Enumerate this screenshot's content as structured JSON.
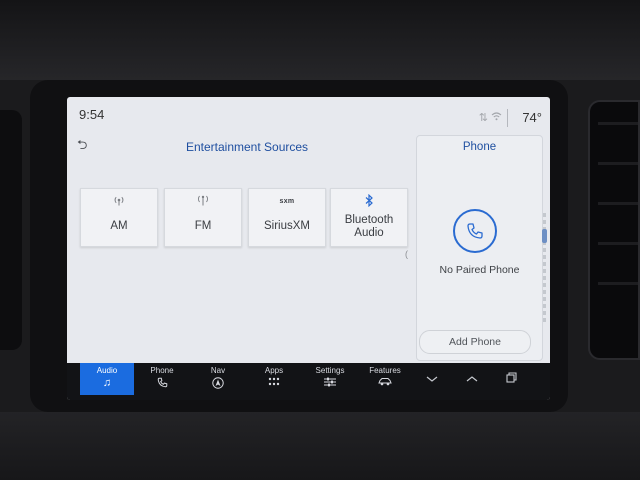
{
  "status": {
    "time": "9:54",
    "temperature": "74°"
  },
  "entertainment": {
    "title": "Entertainment Sources",
    "sources": [
      {
        "label": "AM",
        "icon": "radio-signal-icon"
      },
      {
        "label": "FM",
        "icon": "radio-antenna-icon"
      },
      {
        "label": "SiriusXM",
        "icon": "siriusxm-logo-icon",
        "logo_text": "sxm"
      },
      {
        "label": "Bluetooth Audio",
        "icon": "bluetooth-icon"
      }
    ]
  },
  "phone_panel": {
    "title": "Phone",
    "status": "No Paired Phone",
    "add_button": "Add Phone"
  },
  "bottom_nav": [
    {
      "label": "Audio",
      "icon": "music-note-icon",
      "active": true
    },
    {
      "label": "Phone",
      "icon": "phone-icon"
    },
    {
      "label": "Nav",
      "icon": "navigation-icon"
    },
    {
      "label": "Apps",
      "icon": "apps-grid-icon"
    },
    {
      "label": "Settings",
      "icon": "sliders-icon"
    },
    {
      "label": "Features",
      "icon": "car-icon"
    }
  ],
  "colors": {
    "accent": "#1b6ce0",
    "title_blue": "#1f4fa0",
    "screen_bg": "#e7e9ee",
    "bar_bg": "#121316"
  }
}
